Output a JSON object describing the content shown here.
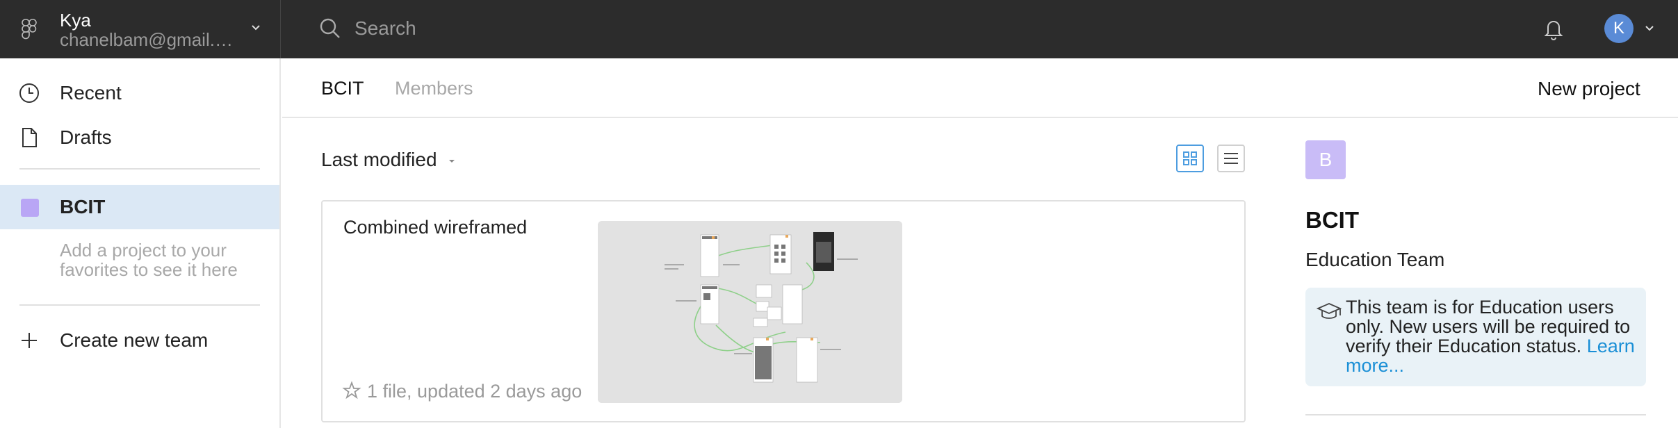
{
  "account": {
    "name": "Kya",
    "email": "chanelbam@gmail.com"
  },
  "search": {
    "placeholder": "Search"
  },
  "user": {
    "initial": "K"
  },
  "sidebar": {
    "recent": "Recent",
    "drafts": "Drafts",
    "team": "BCIT",
    "favorites_hint": "Add a project to your favorites to see it here",
    "create_team": "Create new team"
  },
  "main": {
    "tabs": [
      "BCIT",
      "Members"
    ],
    "new_project": "New project",
    "sort_label": "Last modified"
  },
  "projects": [
    {
      "title": "Combined wireframed",
      "meta": "1 file, updated 2 days ago"
    }
  ],
  "team_panel": {
    "initial": "B",
    "name": "BCIT",
    "type": "Education Team",
    "note": "This team is for Education users only. New users will be required to verify their Education status.",
    "link": "Learn more..."
  },
  "colors": {
    "topbar": "#2c2c2c",
    "selected_row": "#dbe8f5",
    "team_color": "#b9a6f5",
    "avatar": "#5a8bd6",
    "link": "#1a8fd6",
    "note_bg": "#e9f2f7"
  }
}
